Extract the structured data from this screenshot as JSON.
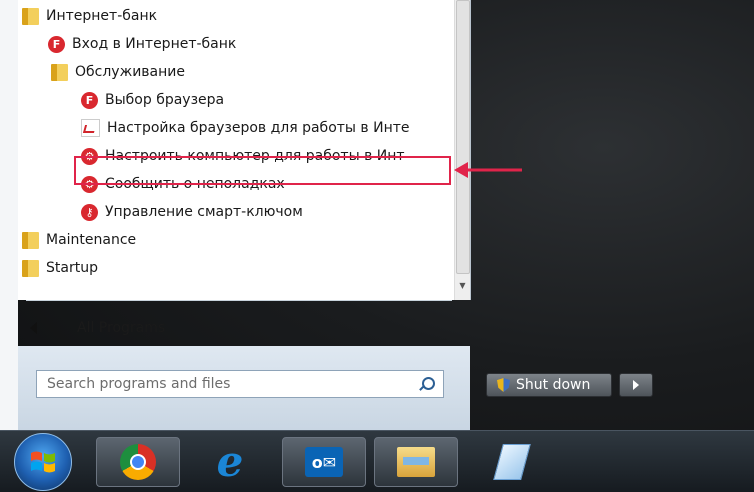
{
  "programs": {
    "items": [
      {
        "label": "Интернет-банк",
        "icon": "folder-icon",
        "indent": 0
      },
      {
        "label": "Вход в Интернет-банк",
        "icon": "bank-app-icon",
        "indent": 1
      },
      {
        "label": "Обслуживание",
        "icon": "folder-icon",
        "indent": 1
      },
      {
        "label": "Выбор браузера",
        "icon": "bank-app-icon",
        "indent": 2
      },
      {
        "label": "Настройка браузеров для работы в Инте",
        "icon": "pdf-icon",
        "indent": 2
      },
      {
        "label": "Настроить компьютер для работы в Инт",
        "icon": "gear-icon",
        "indent": 2
      },
      {
        "label": "Сообщить о неполадках",
        "icon": "gear-icon",
        "indent": 2
      },
      {
        "label": "Управление смарт-ключом",
        "icon": "key-icon",
        "indent": 2
      },
      {
        "label": "Maintenance",
        "icon": "folder-icon",
        "indent": 0
      },
      {
        "label": "Startup",
        "icon": "folder-icon",
        "indent": 0
      }
    ]
  },
  "all_programs_label": "All Programs",
  "search": {
    "placeholder": "Search programs and files"
  },
  "shutdown": {
    "label": "Shut down"
  },
  "colors": {
    "highlight": "#e0244a",
    "accent": "#d9282f"
  },
  "taskbar": {
    "buttons": [
      "start-orb",
      "chrome-icon",
      "internet-explorer-icon",
      "outlook-icon",
      "file-explorer-icon",
      "notepad-icon"
    ]
  }
}
